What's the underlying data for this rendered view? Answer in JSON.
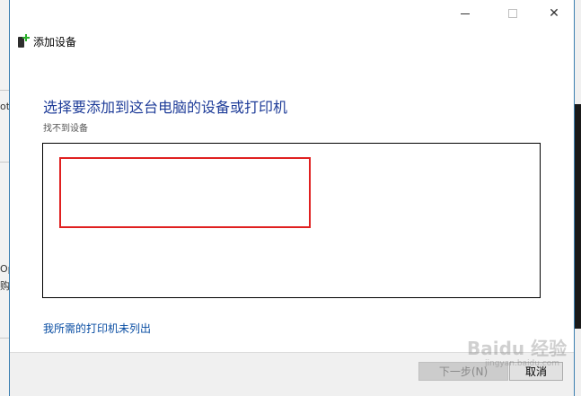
{
  "window": {
    "title": "添加设备",
    "minimize_icon": "minimize-icon",
    "maximize_icon": "maximize-icon",
    "close_icon": "close-icon",
    "close_glyph": "✕"
  },
  "main": {
    "heading": "选择要添加到这台电脑的设备或打印机",
    "status": "找不到设备",
    "printer_link": "我所需的打印机未列出"
  },
  "footer": {
    "next_label": "下一步(N)",
    "cancel_label": "取消"
  },
  "background": {
    "left_text_1": "ot",
    "left_text_2": "Op",
    "left_text_3": "购"
  },
  "watermark": {
    "main": "Baidu 经验",
    "sub": "jingyan.baidu.com"
  },
  "colors": {
    "heading": "#1f3d99",
    "link": "#0a4ea3",
    "highlight": "#e02020"
  }
}
